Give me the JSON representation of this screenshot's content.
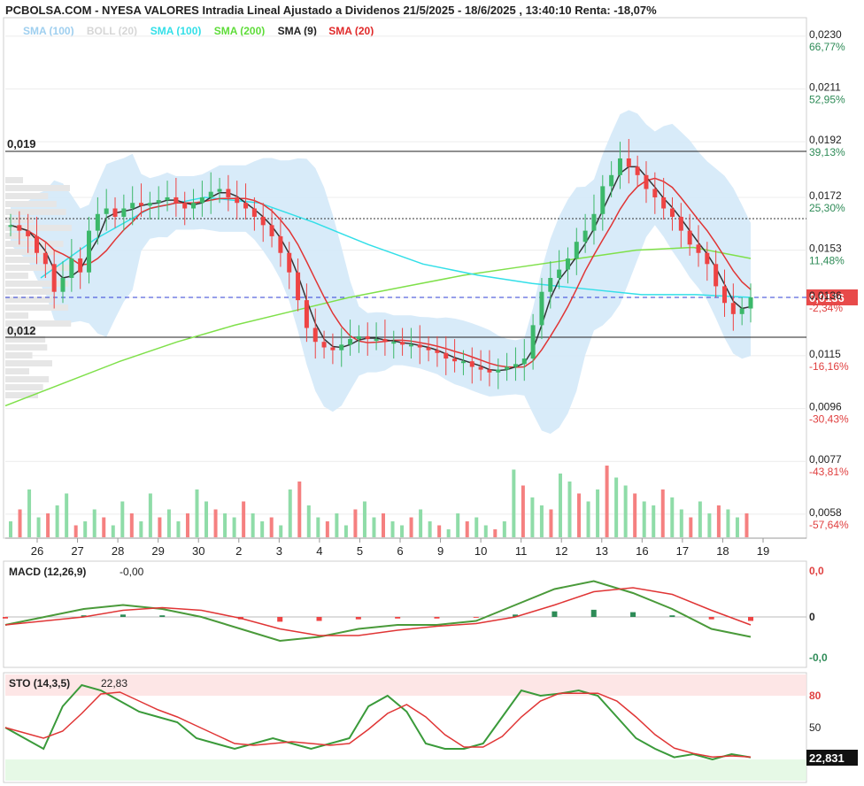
{
  "header": {
    "title": "PCBOLSA.COM - NYESA VALORES Intradia Lineal Ajustado a Dividenos 21/5/2025 - 18/6/2025 , 13:40:10 Renta: -18,07%"
  },
  "legend": [
    {
      "label": "SMA (100)",
      "color": "#9fcfef"
    },
    {
      "label": "BOLL (20)",
      "color": "#d6d6d6"
    },
    {
      "label": "SMA (100)",
      "color": "#33dfe8"
    },
    {
      "label": "SMA (200)",
      "color": "#5fdc3a"
    },
    {
      "label": "SMA (9)",
      "color": "#222222"
    },
    {
      "label": "SMA (20)",
      "color": "#e02a2a"
    }
  ],
  "colors": {
    "up": "#3cb86a",
    "down": "#ee4444",
    "vol_up": "#8fdca8",
    "vol_down": "#f58080",
    "boll_fill": "#d4e9f8",
    "sma100": "#33dfe8",
    "sma200": "#7fe04a",
    "sma9": "#333333",
    "sma20": "#e03535",
    "last_price_bg": "#e84a4a",
    "dashed": "#2f3fd6"
  },
  "price_axis": [
    {
      "price": "0,0230",
      "pct": "66,77%"
    },
    {
      "price": "0,0211",
      "pct": "52,95%"
    },
    {
      "price": "0,0192",
      "pct": "39,13%"
    },
    {
      "price": "0,0172",
      "pct": "25,30%"
    },
    {
      "price": "0,0153",
      "pct": "11,48%"
    },
    {
      "price": "0,0136",
      "pct": "-2,34%"
    },
    {
      "price": "0,0115",
      "pct": "-16,16%"
    },
    {
      "price": "0,0096",
      "pct": "-30,43%"
    },
    {
      "price": "0,0077",
      "pct": "-43,81%"
    },
    {
      "price": "0,0058",
      "pct": "-57,64%"
    }
  ],
  "last_price": "0,0136",
  "levels": {
    "high": "0,019",
    "low": "0,012"
  },
  "x_axis": [
    "26",
    "27",
    "28",
    "29",
    "30",
    "2",
    "3",
    "4",
    "5",
    "6",
    "9",
    "10",
    "11",
    "12",
    "13",
    "16",
    "17",
    "18",
    "19"
  ],
  "macd": {
    "label": "MACD (12,26,9)",
    "value": "-0,00",
    "axis": [
      "0,0",
      "0",
      "-0,0"
    ]
  },
  "sto": {
    "label": "STO (14,3,5)",
    "value": "22,83",
    "axis": [
      "80",
      "50"
    ],
    "last": "22,831"
  },
  "chart_data": {
    "type": "candlestick",
    "title": "PCBOLSA.COM - NYESA VALORES Intradia Lineal Ajustado a Dividenos 21/5/2025 - 18/6/2025 , 13:40:10 Renta: -18,07%",
    "ylim": [
      0.005,
      0.0236
    ],
    "price_series": [
      0.0162,
      0.016,
      0.0158,
      0.0152,
      0.0148,
      0.0138,
      0.0143,
      0.015,
      0.0145,
      0.016,
      0.0166,
      0.0168,
      0.0165,
      0.0168,
      0.017,
      0.0169,
      0.017,
      0.0171,
      0.0172,
      0.017,
      0.0168,
      0.017,
      0.0172,
      0.0174,
      0.0175,
      0.0172,
      0.017,
      0.0168,
      0.0165,
      0.0162,
      0.0158,
      0.0152,
      0.0145,
      0.0135,
      0.0125,
      0.012,
      0.0118,
      0.0117,
      0.0119,
      0.0121,
      0.0122,
      0.0121,
      0.0121,
      0.012,
      0.012,
      0.0119,
      0.0119,
      0.0118,
      0.0117,
      0.0116,
      0.0114,
      0.0113,
      0.0113,
      0.0111,
      0.011,
      0.0109,
      0.011,
      0.0111,
      0.0112,
      0.0114,
      0.0126,
      0.0138,
      0.0143,
      0.0146,
      0.015,
      0.0156,
      0.016,
      0.0166,
      0.0176,
      0.018,
      0.0186,
      0.0183,
      0.018,
      0.0175,
      0.0172,
      0.0168,
      0.0165,
      0.016,
      0.0155,
      0.0152,
      0.0148,
      0.014,
      0.0134,
      0.013,
      0.0132,
      0.0136
    ],
    "sma100_series": [
      0.0143,
      0.0157,
      0.0168,
      0.0172,
      0.017,
      0.0163,
      0.0155,
      0.0148,
      0.0144,
      0.0141,
      0.0139,
      0.0137,
      0.0137,
      0.0136
    ],
    "sma200_series": [
      0.0097,
      0.0105,
      0.0113,
      0.012,
      0.0126,
      0.0131,
      0.0136,
      0.014,
      0.0144,
      0.0147,
      0.015,
      0.0153,
      0.0154,
      0.015
    ],
    "volume_pct": [
      20,
      35,
      60,
      25,
      30,
      40,
      55,
      15,
      20,
      35,
      25,
      15,
      45,
      30,
      20,
      55,
      25,
      35,
      20,
      30,
      60,
      45,
      35,
      30,
      25,
      45,
      30,
      20,
      25,
      15,
      60,
      70,
      40,
      25,
      20,
      30,
      15,
      35,
      45,
      25,
      30,
      20,
      15,
      25,
      35,
      20,
      15,
      10,
      30,
      20,
      25,
      15,
      10,
      20,
      85,
      65,
      50,
      40,
      35,
      80,
      70,
      55,
      45,
      60,
      90,
      75,
      65,
      55,
      45,
      40,
      60,
      50,
      35,
      25,
      45,
      30,
      40,
      35,
      25,
      30
    ],
    "macd_series": [
      -0.0002,
      0.0,
      0.0002,
      0.0003,
      0.0002,
      0.0,
      -0.0003,
      -0.0006,
      -0.0005,
      -0.0003,
      -0.0002,
      -0.0002,
      -0.0001,
      0.0003,
      0.0007,
      0.0009,
      0.0006,
      0.0002,
      -0.0003,
      -0.0005
    ],
    "sto_series": [
      50,
      40,
      30,
      70,
      90,
      85,
      75,
      65,
      60,
      55,
      40,
      35,
      30,
      35,
      40,
      35,
      30,
      35,
      40,
      70,
      80,
      65,
      35,
      30,
      30,
      35,
      60,
      85,
      80,
      82,
      85,
      80,
      60,
      40,
      30,
      22,
      25,
      20,
      25,
      22
    ]
  }
}
